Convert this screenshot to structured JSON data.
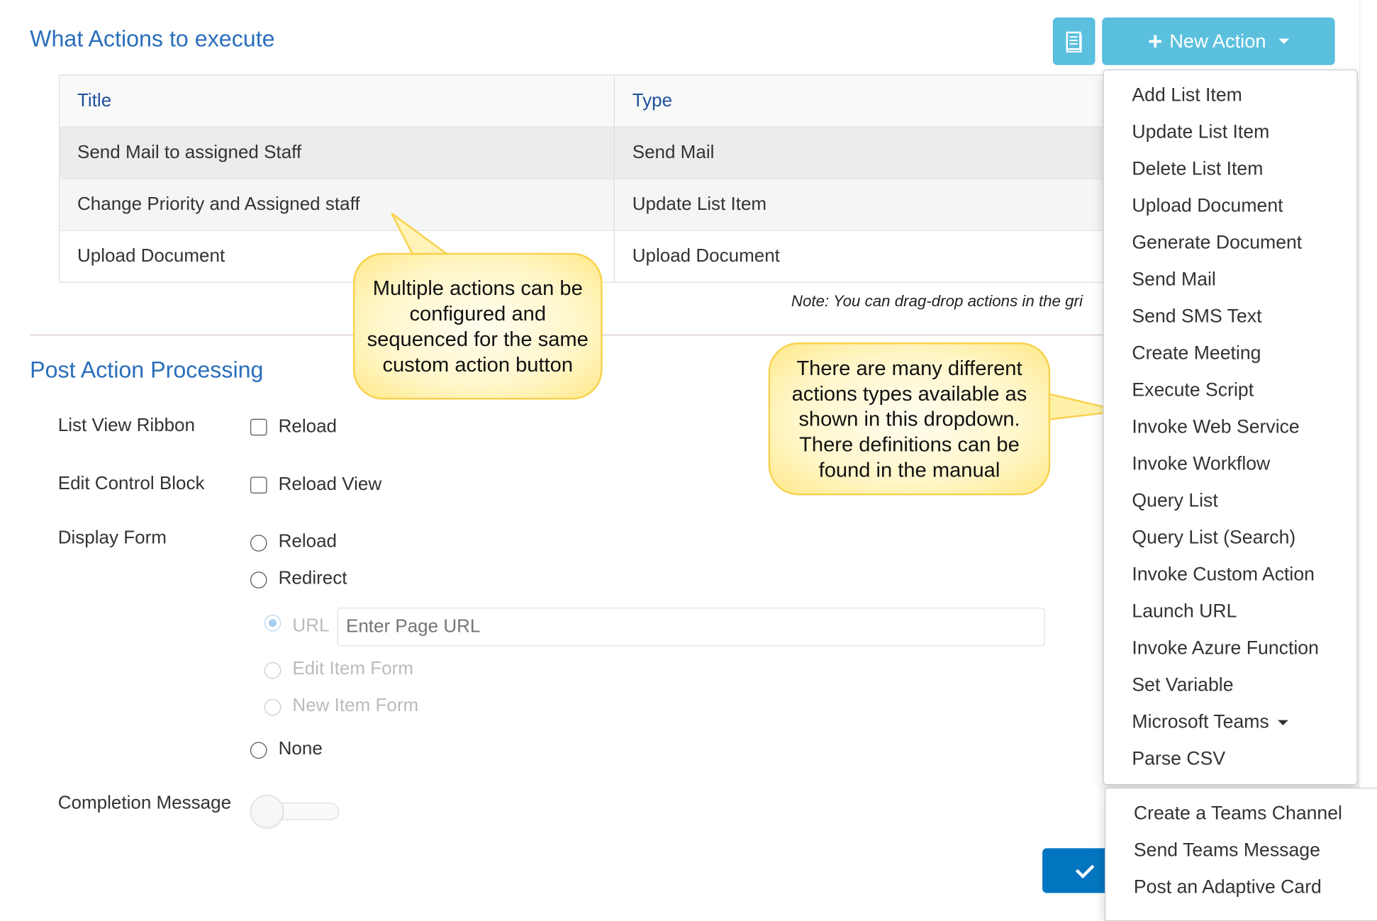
{
  "actions_section": {
    "title": "What Actions to execute",
    "manual_icon": "book-icon",
    "new_action_label": "New Action",
    "table": {
      "headers": [
        "Title",
        "Type"
      ],
      "rows": [
        {
          "title": "Send Mail to assigned Staff",
          "type": "Send Mail"
        },
        {
          "title": "Change Priority and Assigned staff",
          "type": "Update List Item"
        },
        {
          "title": "Upload Document",
          "type": "Upload Document"
        }
      ]
    },
    "note": "Note: You can drag-drop actions in the gri"
  },
  "dropdown": {
    "items": [
      "Add List Item",
      "Update List Item",
      "Delete List Item",
      "Upload Document",
      "Generate Document",
      "Send Mail",
      "Send SMS Text",
      "Create Meeting",
      "Execute Script",
      "Invoke Web Service",
      "Invoke Workflow",
      "Query List",
      "Query List (Search)",
      "Invoke Custom Action",
      "Launch URL",
      "Invoke Azure Function",
      "Set Variable",
      "Microsoft Teams",
      "Parse CSV"
    ],
    "submenu": [
      "Create a Teams Channel",
      "Send Teams Message",
      "Post an Adaptive Card"
    ]
  },
  "callouts": {
    "multiple": "Multiple actions can be configured and sequenced for the same custom action button",
    "types": "There are many different actions types available as shown in this dropdown. There definitions can be found in the manual"
  },
  "post_action": {
    "title": "Post Action Processing",
    "list_view_ribbon": {
      "label": "List View Ribbon",
      "option": "Reload",
      "checked": false
    },
    "edit_control_block": {
      "label": "Edit Control Block",
      "option": "Reload View",
      "checked": false
    },
    "display_form": {
      "label": "Display Form",
      "options": [
        "Reload",
        "Redirect",
        "None"
      ],
      "redirect": {
        "url_label": "URL",
        "url_placeholder": "Enter Page URL",
        "url_value": "",
        "edit_item_form": "Edit Item Form",
        "new_item_form": "New Item Form"
      }
    },
    "completion_message": {
      "label": "Completion Message",
      "enabled": false
    }
  },
  "colors": {
    "heading": "#2a6ebb",
    "info_button": "#5bc0de",
    "save_button": "#0275c0",
    "callout_border": "#f8d24c"
  }
}
